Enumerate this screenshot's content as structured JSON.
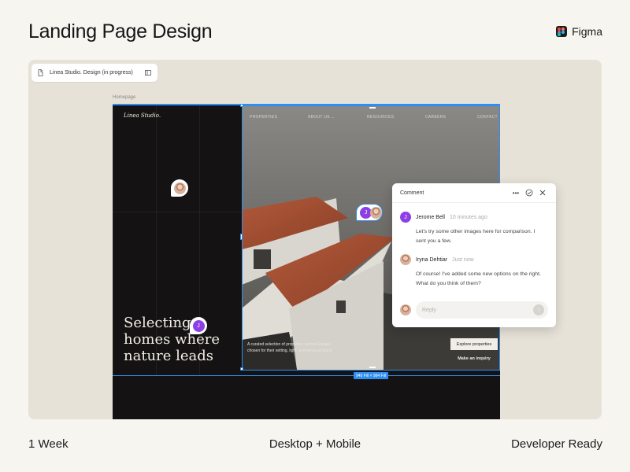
{
  "header": {
    "title": "Landing Page Design",
    "brand": "Figma"
  },
  "file": {
    "name": "Linea Studio. Design (in progress)"
  },
  "frame": {
    "label": "Homepage",
    "size": "949 Fill × 984 Fill"
  },
  "site": {
    "logo": "Linea Studio.",
    "nav": [
      "PROPERTIES",
      "ABOUT US ⌄",
      "RESOURCES",
      "CAREERS",
      "CONTACT"
    ],
    "hero": "Selecting homes where nature leads",
    "caption": "A curated selection of properties across Europe, chosen for their setting, light, and sense of place.",
    "explore": "Explore properties",
    "inquiry": "Make an inquiry"
  },
  "pins": {
    "initial": "J"
  },
  "comment": {
    "title": "Comment",
    "messages": [
      {
        "initial": "J",
        "name": "Jerome Bell",
        "time": "10 minutes ago",
        "text": "Let's try some other images here for comparison. I sent you a few."
      },
      {
        "name": "Iryna Dehtiar",
        "time": "Just now",
        "text": "Of course! I've added some new options on the right. What do you think of them?"
      }
    ],
    "reply_placeholder": "Reply"
  },
  "footer": {
    "left": "1 Week",
    "center": "Desktop + Mobile",
    "right": "Developer Ready"
  },
  "colors": {
    "selection": "#2f8ef0",
    "avatar_purple": "#8b3fe5",
    "canvas_dark": "#141212",
    "stage": "#e6e2d8"
  }
}
